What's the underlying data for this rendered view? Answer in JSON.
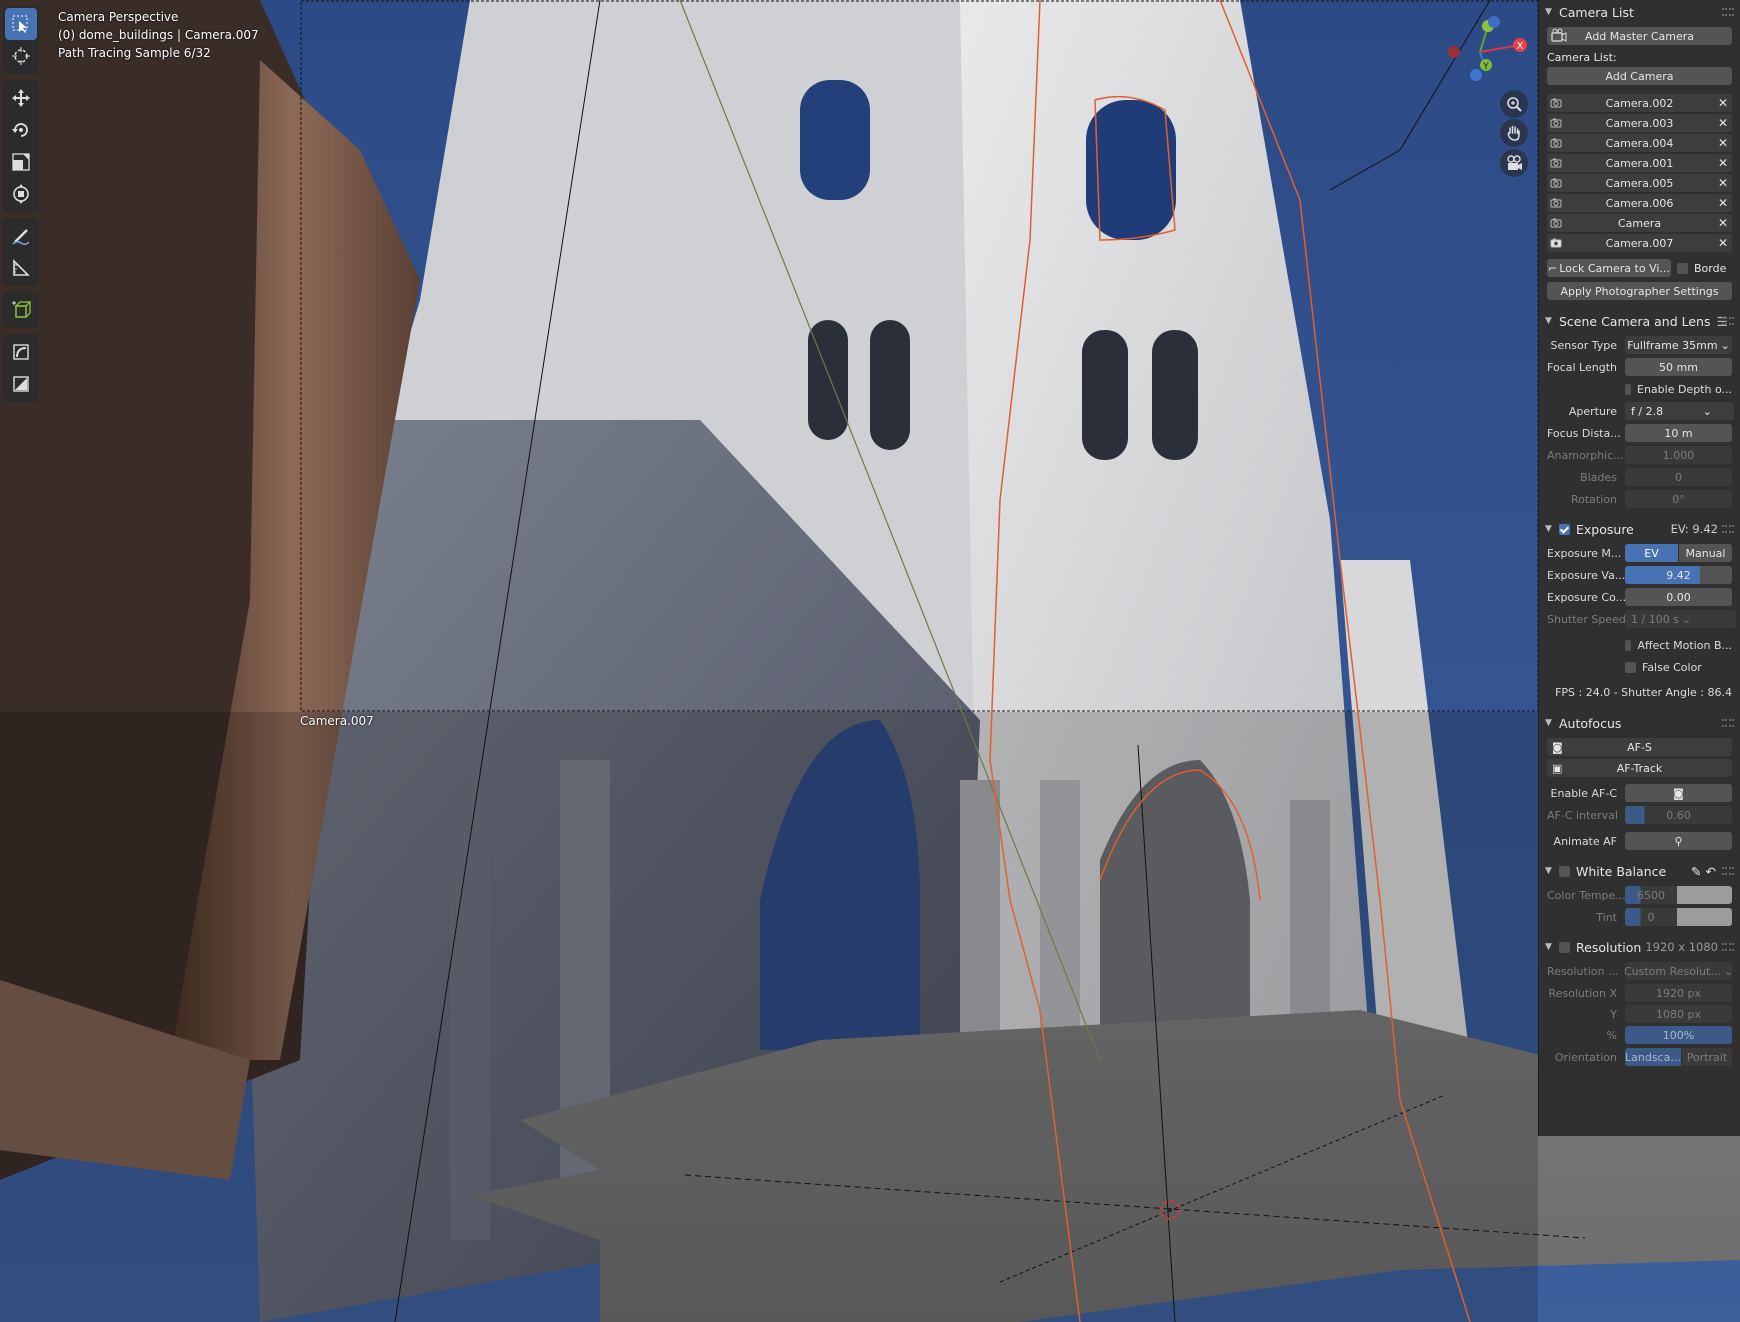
{
  "viewport": {
    "overlay": {
      "mode": "Camera Perspective",
      "object": "(0) dome_buildings | Camera.007",
      "samples": "Path Tracing Sample 6/32"
    },
    "camera_frame_label": "Camera.007",
    "gizmo_axes": [
      "X",
      "Y",
      "Z"
    ]
  },
  "toolbar": {
    "tools": [
      "select-box-icon",
      "cursor-icon",
      "move-icon",
      "rotate-icon",
      "scale-icon",
      "transform-icon",
      "annotate-icon",
      "measure-icon",
      "add-cube-icon",
      "shear-icon",
      "render-region-icon"
    ]
  },
  "panel": {
    "camera_list": {
      "header": "Camera List",
      "add_master": "Add Master Camera",
      "list_label": "Camera List:",
      "add_camera": "Add Camera",
      "cameras": [
        "Camera.002",
        "Camera.003",
        "Camera.004",
        "Camera.001",
        "Camera.005",
        "Camera.006",
        "Camera",
        "Camera.007"
      ],
      "active_camera": "Camera.007",
      "lock_camera": "Lock Camera to Vi...",
      "border": "Borde",
      "apply_settings": "Apply Photographer Settings"
    },
    "scene_camera": {
      "header": "Scene Camera and Lens",
      "sensor_type_label": "Sensor Type",
      "sensor_type": "Fullframe 35mm",
      "focal_length_label": "Focal Length",
      "focal_length": "50 mm",
      "enable_dof": "Enable Depth o...",
      "aperture_label": "Aperture",
      "aperture": "f / 2.8",
      "focus_distance_label": "Focus Dista...",
      "focus_distance": "10 m",
      "anamorphic_label": "Anamorphic...",
      "anamorphic": "1.000",
      "blades_label": "Blades",
      "blades": "0",
      "rotation_label": "Rotation",
      "rotation": "0°"
    },
    "exposure": {
      "header": "Exposure",
      "ev_summary": "EV: 9.42",
      "mode_label": "Exposure M...",
      "mode_ev": "EV",
      "mode_manual": "Manual",
      "value_label": "Exposure Va...",
      "value": "9.42",
      "comp_label": "Exposure Co...",
      "comp": "0.00",
      "shutter_label": "Shutter Speed",
      "shutter": "1 / 100 s",
      "affect_motion": "Affect Motion B...",
      "false_color": "False Color",
      "fps": "FPS : 24.0 - Shutter Angle : 86.4"
    },
    "autofocus": {
      "header": "Autofocus",
      "afs": "AF-S",
      "af_track": "AF-Track",
      "enable_afc_label": "Enable AF-C",
      "afc_interval_label": "AF-C interval",
      "afc_interval": "0.60",
      "animate_af_label": "Animate AF"
    },
    "white_balance": {
      "header": "White Balance",
      "color_temp_label": "Color Tempe...",
      "color_temp": "6500",
      "tint_label": "Tint",
      "tint": "0"
    },
    "resolution": {
      "header": "Resolution",
      "summary": "1920 x 1080",
      "preset_label": "Resolution ...",
      "preset": "Custom Resolut...",
      "x_label": "Resolution X",
      "x": "1920 px",
      "y_label": "Y",
      "y": "1080 px",
      "pct_label": "%",
      "pct": "100%",
      "orientation_label": "Orientation",
      "landscape": "Landsca...",
      "portrait": "Portrait"
    }
  }
}
